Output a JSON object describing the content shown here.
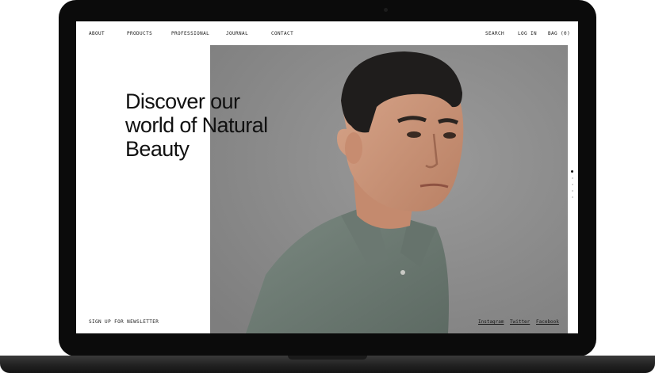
{
  "nav": {
    "about": "ABOUT",
    "products": "PRODUCTS",
    "professional": "PROFESSIONAL",
    "journal": "JOURNAL",
    "contact": "CONTACT",
    "search": "SEARCH",
    "login": "LOG IN",
    "bag": "BAG (0)"
  },
  "hero": {
    "headline_lines": [
      "Discover our",
      "world of Natural",
      "Beauty"
    ]
  },
  "footer": {
    "newsletter": "SIGN UP FOR NEWSLETTER",
    "social": [
      "Instagram",
      "Twitter",
      "Facebook"
    ]
  },
  "slider": {
    "count": 5,
    "active_index": 0
  },
  "colors": {
    "photo_background": "#8c8c8c",
    "shirt": "#6f7d74",
    "text": "#111111",
    "bezel": "#0b0b0b"
  }
}
